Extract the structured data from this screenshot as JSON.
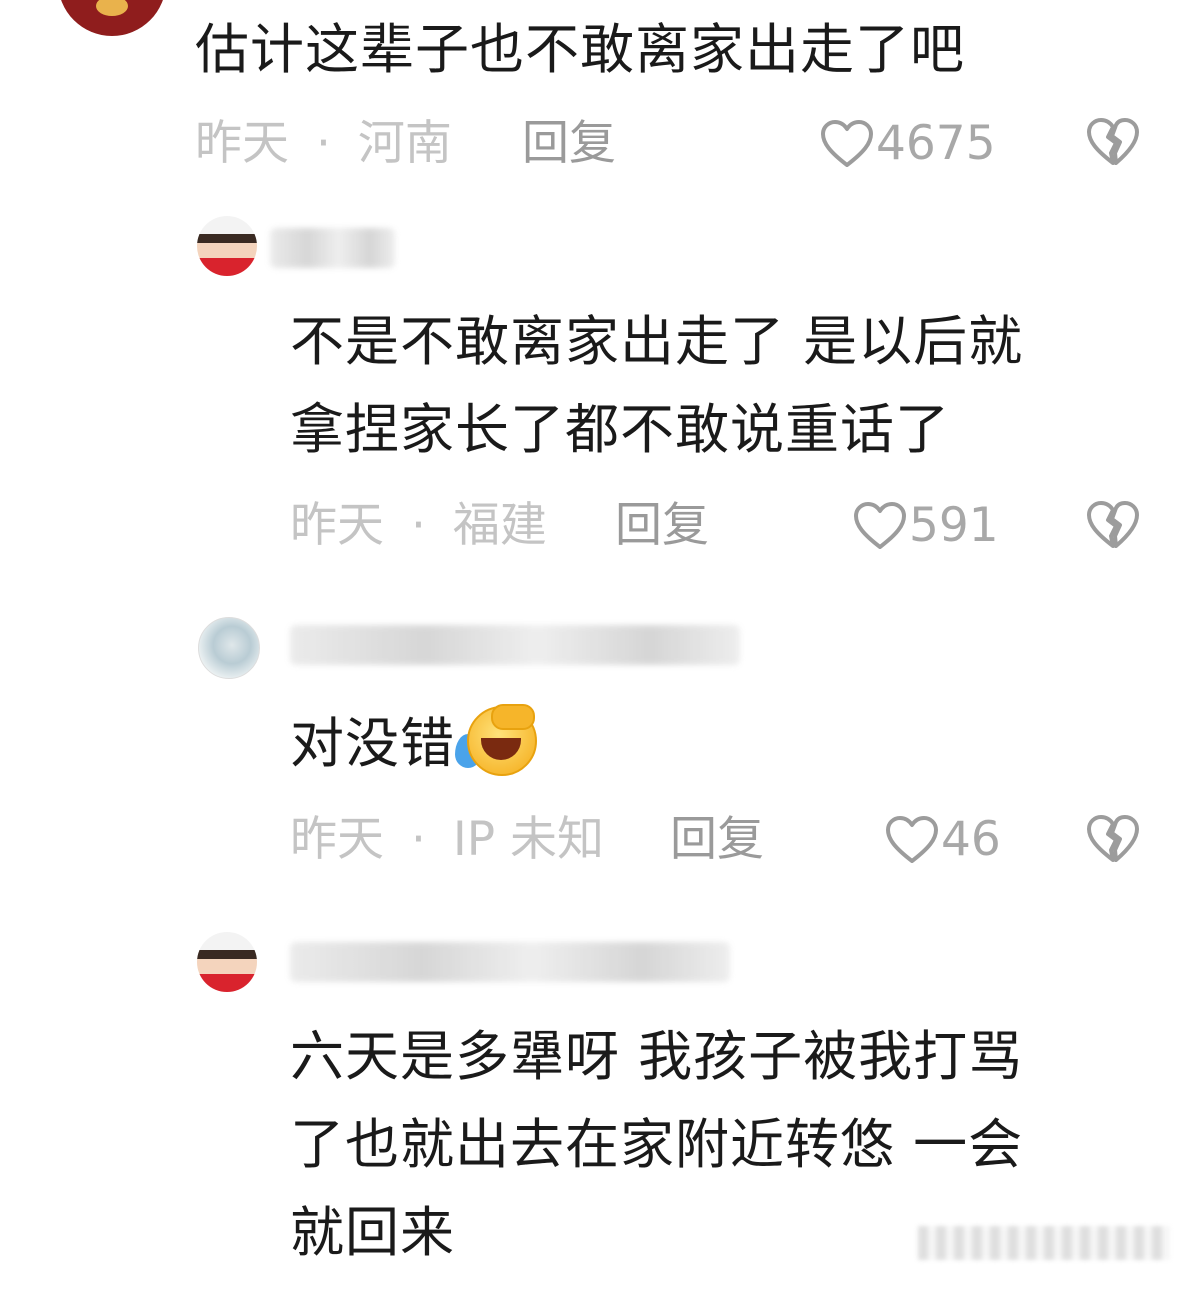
{
  "top_comment": {
    "text": "估计这辈子也不敢离家出走了吧",
    "time": "昨天",
    "location": "河南",
    "reply_label": "回复",
    "likes": "4675"
  },
  "replies": [
    {
      "lines": [
        "不是不敢离家出走了 是以后就",
        "拿捏家长了都不敢说重话了"
      ],
      "time": "昨天",
      "location": "福建",
      "reply_label": "回复",
      "likes": "591"
    },
    {
      "lines": [
        "对没错"
      ],
      "emoji": "rofl-emoji",
      "time": "昨天",
      "location": "IP 未知",
      "reply_label": "回复",
      "likes": "46"
    },
    {
      "lines": [
        "六天是多犟呀 我孩子被我打骂",
        "了也就出去在家附近转悠 一会",
        "就回来"
      ]
    }
  ],
  "separator": "·",
  "icons": {
    "like": "heart-outline-icon",
    "dislike": "broken-heart-icon"
  },
  "colors": {
    "text": "#1a1a1a",
    "meta": "#c4c4c4",
    "reply": "#9a9a9a",
    "likes": "#a8a8a8"
  }
}
